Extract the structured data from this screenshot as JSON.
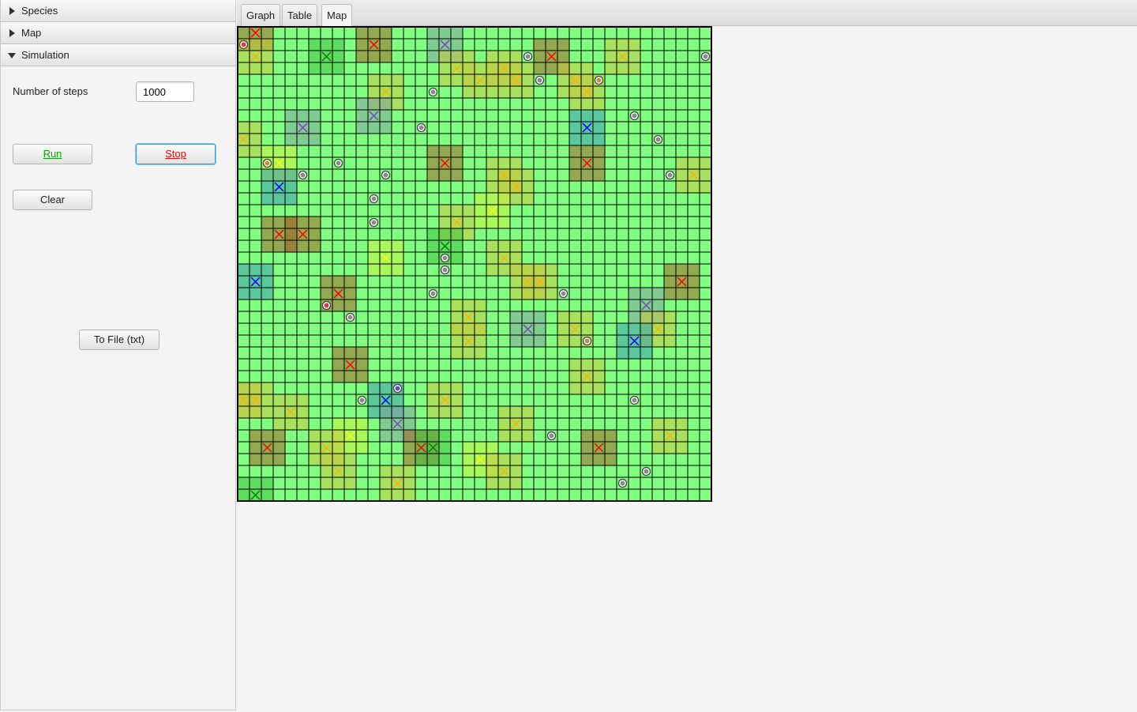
{
  "sidebar": {
    "sections": [
      {
        "label": "Species",
        "expanded": false
      },
      {
        "label": "Map",
        "expanded": false
      },
      {
        "label": "Simulation",
        "expanded": true
      }
    ],
    "simulation": {
      "steps_label": "Number of steps",
      "steps_value": "1000",
      "run_label": "Run",
      "stop_label": "Stop",
      "clear_label": "Clear",
      "tofile_label": "To File (txt)"
    }
  },
  "tabs": [
    {
      "label": "Graph",
      "selected": false
    },
    {
      "label": "Table",
      "selected": false
    },
    {
      "label": "Map",
      "selected": true
    }
  ],
  "map": {
    "grid_cols": 40,
    "grid_rows": 40,
    "background_color": "#80ff80",
    "grid_line_color": "#000000",
    "species_colors": {
      "red": "#ff0000",
      "orange": "#ffb000",
      "yellow": "#ffff00",
      "green": "#008000",
      "blue": "#0000ff",
      "purple": "#8040c0"
    },
    "agents": [
      {
        "col": 1,
        "row": 0,
        "species": "red"
      },
      {
        "col": 1,
        "row": 2,
        "species": "orange"
      },
      {
        "col": 7,
        "row": 2,
        "species": "green"
      },
      {
        "col": 11,
        "row": 1,
        "species": "red"
      },
      {
        "col": 17,
        "row": 1,
        "species": "purple"
      },
      {
        "col": 18,
        "row": 3,
        "species": "orange"
      },
      {
        "col": 20,
        "row": 4,
        "species": "orange"
      },
      {
        "col": 22,
        "row": 3,
        "species": "orange"
      },
      {
        "col": 23,
        "row": 4,
        "species": "orange"
      },
      {
        "col": 26,
        "row": 2,
        "species": "red"
      },
      {
        "col": 28,
        "row": 4,
        "species": "orange"
      },
      {
        "col": 29,
        "row": 5,
        "species": "orange"
      },
      {
        "col": 32,
        "row": 2,
        "species": "orange"
      },
      {
        "col": 12,
        "row": 5,
        "species": "orange"
      },
      {
        "col": 5,
        "row": 8,
        "species": "purple"
      },
      {
        "col": 11,
        "row": 7,
        "species": "purple"
      },
      {
        "col": 0,
        "row": 9,
        "species": "orange"
      },
      {
        "col": 29,
        "row": 8,
        "species": "blue"
      },
      {
        "col": 3,
        "row": 11,
        "species": "yellow"
      },
      {
        "col": 17,
        "row": 11,
        "species": "red"
      },
      {
        "col": 22,
        "row": 12,
        "species": "orange"
      },
      {
        "col": 23,
        "row": 13,
        "species": "orange"
      },
      {
        "col": 29,
        "row": 11,
        "species": "red"
      },
      {
        "col": 38,
        "row": 12,
        "species": "orange"
      },
      {
        "col": 3,
        "row": 13,
        "species": "blue"
      },
      {
        "col": 21,
        "row": 15,
        "species": "yellow"
      },
      {
        "col": 18,
        "row": 16,
        "species": "orange"
      },
      {
        "col": 3,
        "row": 17,
        "species": "red"
      },
      {
        "col": 5,
        "row": 17,
        "species": "red"
      },
      {
        "col": 17,
        "row": 18,
        "species": "green"
      },
      {
        "col": 12,
        "row": 19,
        "species": "yellow"
      },
      {
        "col": 22,
        "row": 19,
        "species": "orange"
      },
      {
        "col": 1,
        "row": 21,
        "species": "blue"
      },
      {
        "col": 24,
        "row": 21,
        "species": "orange"
      },
      {
        "col": 25,
        "row": 21,
        "species": "orange"
      },
      {
        "col": 37,
        "row": 21,
        "species": "red"
      },
      {
        "col": 8,
        "row": 22,
        "species": "red"
      },
      {
        "col": 34,
        "row": 23,
        "species": "purple"
      },
      {
        "col": 19,
        "row": 24,
        "species": "orange"
      },
      {
        "col": 24,
        "row": 25,
        "species": "purple"
      },
      {
        "col": 28,
        "row": 25,
        "species": "orange"
      },
      {
        "col": 35,
        "row": 25,
        "species": "orange"
      },
      {
        "col": 19,
        "row": 26,
        "species": "orange"
      },
      {
        "col": 33,
        "row": 26,
        "species": "blue"
      },
      {
        "col": 9,
        "row": 28,
        "species": "red"
      },
      {
        "col": 29,
        "row": 29,
        "species": "orange"
      },
      {
        "col": 0,
        "row": 31,
        "species": "orange"
      },
      {
        "col": 1,
        "row": 31,
        "species": "orange"
      },
      {
        "col": 12,
        "row": 31,
        "species": "blue"
      },
      {
        "col": 17,
        "row": 31,
        "species": "orange"
      },
      {
        "col": 4,
        "row": 32,
        "species": "orange"
      },
      {
        "col": 13,
        "row": 33,
        "species": "purple"
      },
      {
        "col": 23,
        "row": 33,
        "species": "orange"
      },
      {
        "col": 9,
        "row": 34,
        "species": "yellow"
      },
      {
        "col": 36,
        "row": 34,
        "species": "orange"
      },
      {
        "col": 2,
        "row": 35,
        "species": "red"
      },
      {
        "col": 7,
        "row": 35,
        "species": "orange"
      },
      {
        "col": 15,
        "row": 35,
        "species": "red"
      },
      {
        "col": 16,
        "row": 35,
        "species": "green"
      },
      {
        "col": 30,
        "row": 35,
        "species": "red"
      },
      {
        "col": 20,
        "row": 36,
        "species": "yellow"
      },
      {
        "col": 8,
        "row": 37,
        "species": "orange"
      },
      {
        "col": 22,
        "row": 37,
        "species": "orange"
      },
      {
        "col": 13,
        "row": 38,
        "species": "orange"
      },
      {
        "col": 1,
        "row": 39,
        "species": "green"
      }
    ],
    "dots": [
      {
        "col": 0,
        "row": 1,
        "color": "red"
      },
      {
        "col": 24,
        "row": 2
      },
      {
        "col": 39,
        "row": 2
      },
      {
        "col": 25,
        "row": 4
      },
      {
        "col": 30,
        "row": 4,
        "color": "orange"
      },
      {
        "col": 16,
        "row": 5
      },
      {
        "col": 33,
        "row": 7
      },
      {
        "col": 15,
        "row": 8
      },
      {
        "col": 35,
        "row": 9
      },
      {
        "col": 2,
        "row": 11,
        "color": "orange"
      },
      {
        "col": 8,
        "row": 11
      },
      {
        "col": 5,
        "row": 12
      },
      {
        "col": 12,
        "row": 12
      },
      {
        "col": 36,
        "row": 12
      },
      {
        "col": 11,
        "row": 14
      },
      {
        "col": 11,
        "row": 16
      },
      {
        "col": 17,
        "row": 19
      },
      {
        "col": 17,
        "row": 20
      },
      {
        "col": 16,
        "row": 22
      },
      {
        "col": 27,
        "row": 22
      },
      {
        "col": 7,
        "row": 23,
        "color": "red"
      },
      {
        "col": 9,
        "row": 24
      },
      {
        "col": 29,
        "row": 26,
        "color": "orange"
      },
      {
        "col": 13,
        "row": 30,
        "color": "blue"
      },
      {
        "col": 10,
        "row": 31
      },
      {
        "col": 33,
        "row": 31
      },
      {
        "col": 26,
        "row": 34
      },
      {
        "col": 34,
        "row": 37
      },
      {
        "col": 32,
        "row": 38
      }
    ]
  }
}
